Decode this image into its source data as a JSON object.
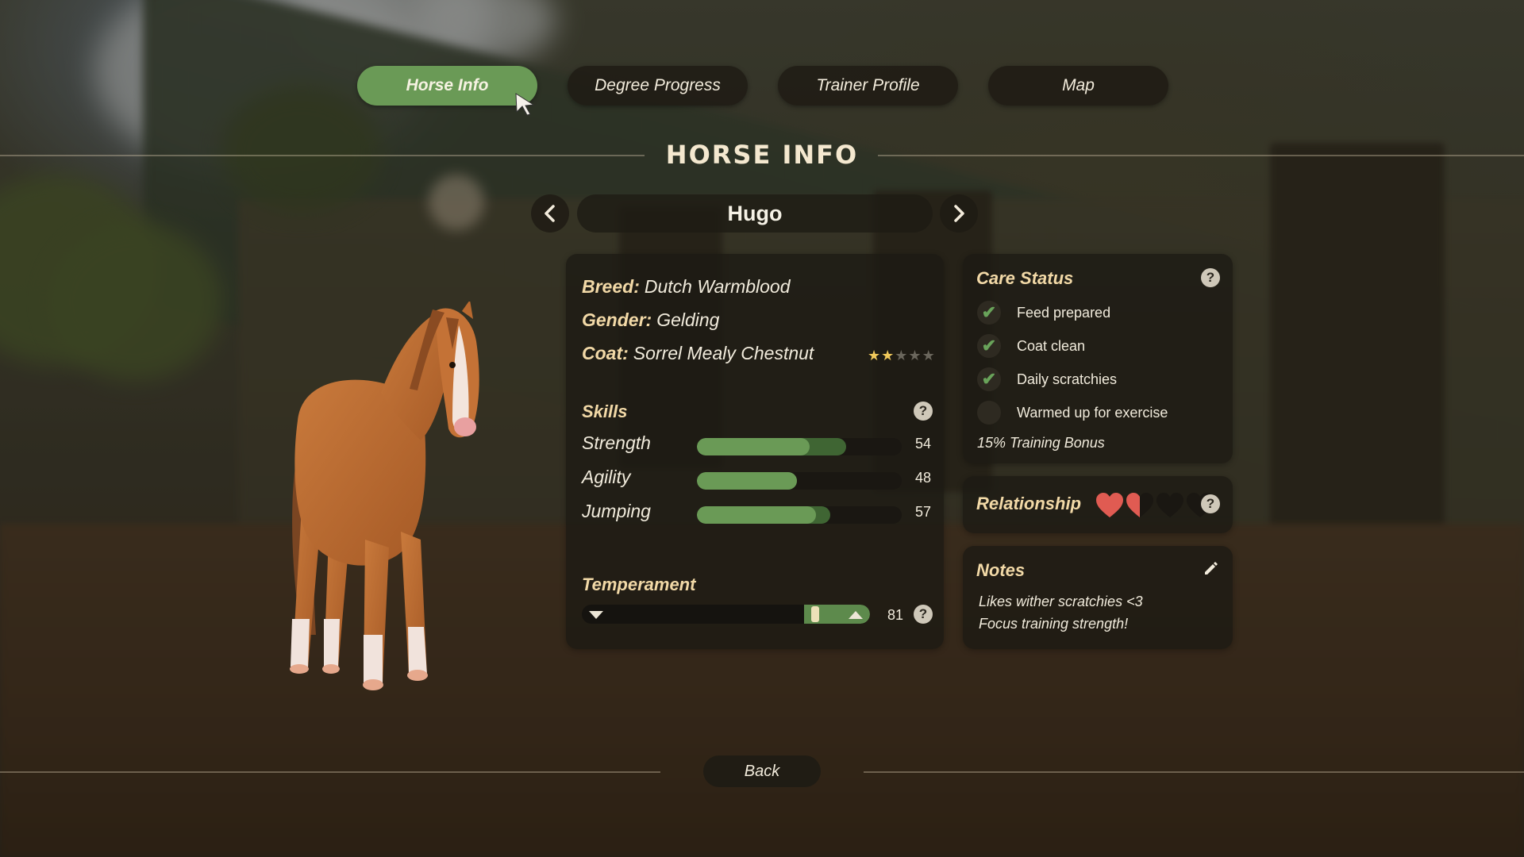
{
  "tabs": [
    {
      "label": "Horse Info",
      "active": true
    },
    {
      "label": "Degree Progress",
      "active": false
    },
    {
      "label": "Trainer Profile",
      "active": false
    },
    {
      "label": "Map",
      "active": false
    }
  ],
  "page_title": "HORSE INFO",
  "horse": {
    "name": "Hugo",
    "breed_label": "Breed:",
    "breed": "Dutch Warmblood",
    "gender_label": "Gender:",
    "gender": "Gelding",
    "coat_label": "Coat:",
    "coat": "Sorrel Mealy Chestnut",
    "coat_rarity_stars": 2,
    "coat_rarity_max": 5
  },
  "skills": {
    "title": "Skills",
    "items": [
      {
        "name": "Strength",
        "value": "54",
        "fill": 0.55,
        "potential": 0.73
      },
      {
        "name": "Agility",
        "value": "48",
        "fill": 0.49,
        "potential": 0.49
      },
      {
        "name": "Jumping",
        "value": "57",
        "fill": 0.58,
        "potential": 0.65
      }
    ]
  },
  "temperament": {
    "title": "Temperament",
    "value": "81",
    "level": 0.81,
    "good_zone_start": 0.77
  },
  "care_status": {
    "title": "Care Status",
    "items": [
      {
        "label": "Feed prepared",
        "done": true
      },
      {
        "label": "Coat clean",
        "done": true
      },
      {
        "label": "Daily scratchies",
        "done": true
      },
      {
        "label": "Warmed up for exercise",
        "done": false
      }
    ],
    "bonus": "15% Training Bonus"
  },
  "relationship": {
    "title": "Relationship",
    "hearts": 1.5,
    "max_hearts": 4,
    "heart_color": "#e05b52"
  },
  "notes": {
    "title": "Notes",
    "lines": [
      "Likes wither scratchies <3",
      "Focus training strength!"
    ]
  },
  "back_label": "Back",
  "icons": {
    "help": "?",
    "prev": "‹",
    "next": "›",
    "check": "✔",
    "star": "★"
  },
  "colors": {
    "accent_green": "#6a9a56",
    "label_gold": "#f2d9a7"
  }
}
